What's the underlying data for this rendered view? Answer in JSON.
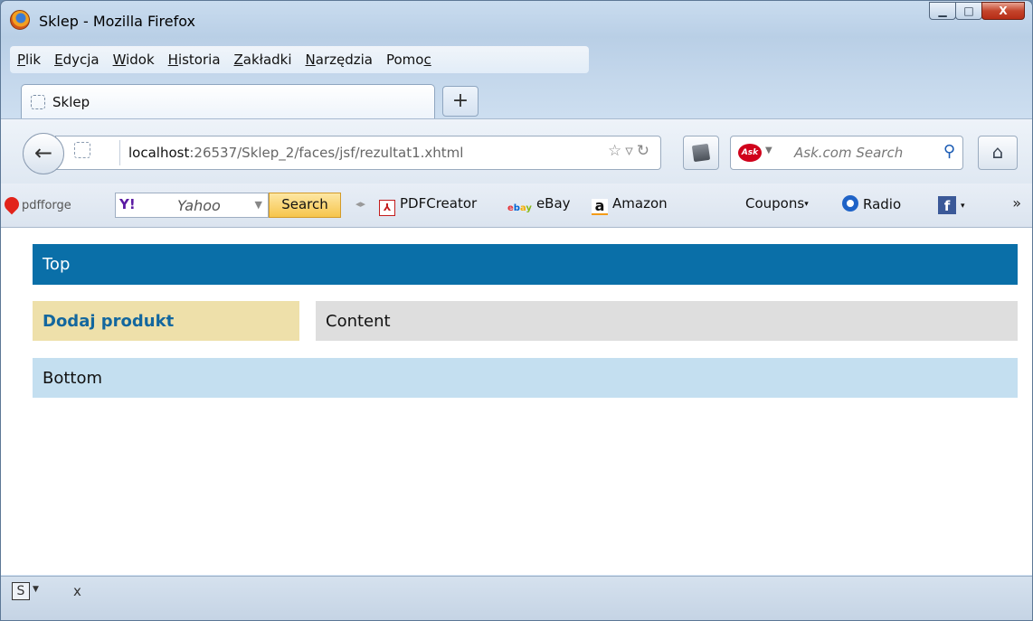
{
  "window": {
    "title": "Sklep - Mozilla Firefox",
    "controls": {
      "minimize": "▁",
      "maximize": "□",
      "close": "X"
    }
  },
  "menubar": {
    "items": [
      {
        "label": "Plik",
        "accel": "P",
        "rest": "lik",
        "accel_pos": "start"
      },
      {
        "label": "Edycja",
        "accel": "E",
        "rest": "dycja",
        "accel_pos": "start"
      },
      {
        "label": "Widok",
        "accel": "W",
        "rest": "idok",
        "accel_pos": "start"
      },
      {
        "label": "Historia",
        "accel": "H",
        "rest": "istoria",
        "accel_pos": "start"
      },
      {
        "label": "Zakładki",
        "accel": "Z",
        "rest": "akładki",
        "accel_pos": "start"
      },
      {
        "label": "Narzędzia",
        "accel": "N",
        "rest": "arzędzia",
        "accel_pos": "start"
      },
      {
        "label": "Pomoc",
        "accel": "c",
        "rest": "Pomo",
        "accel_pos": "end"
      }
    ]
  },
  "tabs": [
    {
      "label": "Sklep",
      "active": true
    }
  ],
  "new_tab_label": "+",
  "navbar": {
    "url_host": "localhost",
    "url_rest": ":26537/Sklep_2/faces/jsf/rezultat1.xhtml",
    "search_placeholder": "Ask.com Search",
    "ask_logo_text": "Ask"
  },
  "bookmarks": {
    "pdfforge_label": "pdfforge",
    "yahoo_logo": "Y!",
    "yahoo_placeholder": "Yahoo",
    "yahoo_search_button": "Search",
    "items": [
      {
        "label": "PDFCreator",
        "icon": "pdf-icon"
      },
      {
        "label": "eBay",
        "icon": "ebay-icon"
      },
      {
        "label": "Amazon",
        "icon": "amazon-icon"
      },
      {
        "label": "Coupons",
        "icon": "none"
      },
      {
        "label": "Radio",
        "icon": "radio-icon"
      }
    ],
    "more": "»"
  },
  "page": {
    "top": "Top",
    "side_link": "Dodaj produkt",
    "content": "Content",
    "bottom": "Bottom",
    "colors": {
      "top_bg": "#0a6fa8",
      "side_bg": "#eee0aa",
      "content_bg": "#dedede",
      "bottom_bg": "#c4dff0",
      "link": "#13679e"
    }
  },
  "statusbar": {
    "addon_icon": "S",
    "close": "x"
  }
}
